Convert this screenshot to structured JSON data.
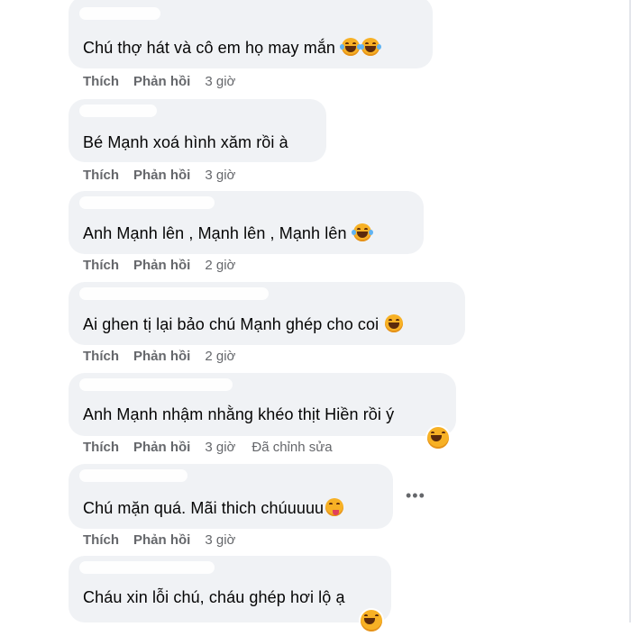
{
  "comments": [
    {
      "text": "Chú thợ hát và cô em họ may mắn",
      "like": "Thích",
      "reply": "Phản hồi",
      "time": "3 giờ",
      "edited": ""
    },
    {
      "text": "Bé Mạnh xoá hình xăm rồi à",
      "like": "Thích",
      "reply": "Phản hồi",
      "time": "3 giờ",
      "edited": ""
    },
    {
      "text": "Anh Mạnh lên , Mạnh lên , Mạnh lên",
      "like": "Thích",
      "reply": "Phản hồi",
      "time": "2 giờ",
      "edited": ""
    },
    {
      "text": "Ai ghen tị lại bảo chú Mạnh ghép cho coi",
      "like": "Thích",
      "reply": "Phản hồi",
      "time": "2 giờ",
      "edited": ""
    },
    {
      "text": "Anh Mạnh nhậm nhằng khéo thịt Hiền rồi ý",
      "like": "Thích",
      "reply": "Phản hồi",
      "time": "3 giờ",
      "edited": "Đã chỉnh sửa"
    },
    {
      "text": "Chú mặn quá. Mãi thich chúuuuu",
      "like": "Thích",
      "reply": "Phản hồi",
      "time": "3 giờ",
      "edited": ""
    },
    {
      "text": "Cháu xin lỗi chú, cháu ghép hơi lộ ạ",
      "like": "",
      "reply": "",
      "time": "",
      "edited": ""
    }
  ],
  "more_menu": "•••",
  "icons": {
    "emoji": "laughing-emoji-icon",
    "tongue": "tongue-emoji-icon",
    "more": "more-options-icon"
  },
  "colors": {
    "bubble": "#f0f2f5",
    "text": "#050505",
    "meta": "#65676b"
  }
}
